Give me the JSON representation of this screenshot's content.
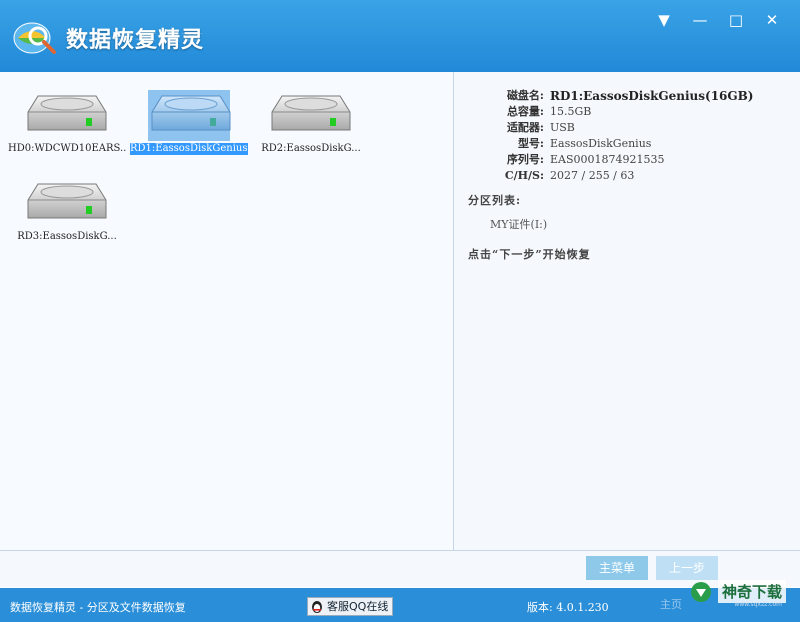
{
  "app": {
    "title": "数据恢复精灵"
  },
  "window_controls": {
    "dropdown": "▼",
    "minimize": "—",
    "maximize": "□",
    "close": "✕"
  },
  "disks": [
    {
      "label": "HD0:WDCWD10EARS..."
    },
    {
      "label": "RD1:EassosDiskGenius(16GB)"
    },
    {
      "label": "RD2:EassosDiskG..."
    },
    {
      "label": "RD3:EassosDiskG..."
    }
  ],
  "details": {
    "disk_name_label": "磁盘名:",
    "disk_name": "RD1:EassosDiskGenius(16GB)",
    "capacity_label": "总容量:",
    "capacity": "15.5GB",
    "adapter_label": "适配器:",
    "adapter": "USB",
    "model_label": "型号:",
    "model": "EassosDiskGenius",
    "serial_label": "序列号:",
    "serial": "EAS0001874921535",
    "chs_label": "C/H/S:",
    "chs": "2027 / 255 / 63",
    "partition_list_label": "分区列表:",
    "partitions": [
      "MY证件(I:)"
    ],
    "hint": "点击“下一步”开始恢复"
  },
  "buttons": {
    "main_menu": "主菜单",
    "prev": "上一步"
  },
  "statusbar": {
    "text": "数据恢复精灵 - 分区及文件数据恢复",
    "qq": "客服QQ在线",
    "version": "版本: 4.0.1.230",
    "faded": "主页"
  },
  "watermark": {
    "name": "神奇下载",
    "url": "www.sqxzz.com"
  },
  "colors": {
    "titlebar": "#2189d8",
    "statusbar": "#2a8fd8",
    "selection": "#3399ff",
    "button": "#8ec9ea"
  }
}
